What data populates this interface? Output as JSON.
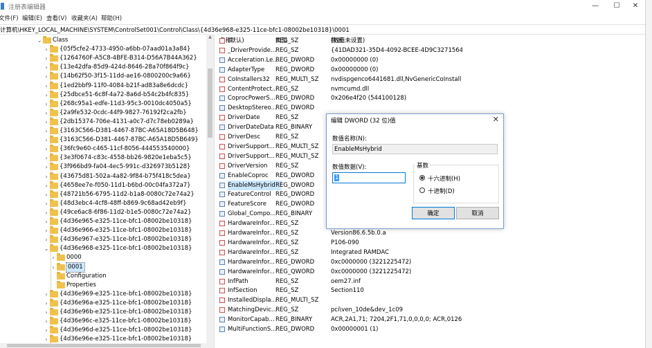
{
  "window": {
    "title": "注册表编辑器",
    "controls": {
      "minimize": "—",
      "maximize": "☐",
      "close": "✕"
    }
  },
  "menu": [
    "文件(F)",
    "编辑(E)",
    "查看(V)",
    "收藏夹(A)",
    "帮助(H)"
  ],
  "address": "计算机\\HKEY_LOCAL_MACHINE\\SYSTEM\\ControlSet001\\Control\\Class\\{4d36e968-e325-11ce-bfc1-08002be10318}\\0001",
  "tree": {
    "root": "Class",
    "items": [
      "{05f5cfe2-4733-4950-a6bb-07aad01a3a84}",
      "{1264760F-A5C8-4BFE-B314-D56A7B44A362}",
      "{13e42dfa-85d9-424d-8646-28a70f864f9c}",
      "{14b62f50-3f15-11dd-ae16-0800200c9a66}",
      "{1ed2bbf9-11f0-4084-b21f-ad83a8e6dcdc}",
      "{25dbce51-6c8f-4a72-8a6d-b54c2b4fc835}",
      "{268c95a1-edfe-11d3-95c3-0010dc4050a5}",
      "{2a9fe532-0cdc-44f9-9827-76192f2ca2fb}",
      "{2db15374-706e-4131-a0c7-d7c78eb0289a}",
      "{3163C566-D381-4467-87BC-A65A18D5B648}",
      "{3163C566-D381-4467-87BC-A65A18D5B649}",
      "{36fc9e60-c465-11cf-8056-444553540000}",
      "{3e3f0674-c83c-4558-bb26-9820e1eba5c5}",
      "{3f966bd9-fa04-4ec5-991c-d326973b5128}",
      "{43675d81-502a-4a82-9f84-b75f418c5dea}",
      "{4658ee7e-f050-11d1-b6bd-00c04fa372a7}",
      "{48721b56-6795-11d2-b1a8-0080c72e74a2}",
      "{48d3ebc4-4cf8-48ff-b869-9c68ad42eb9f}",
      "{49ce6ac8-6f86-11d2-b1e5-0080c72e74a2}",
      "{4d36e965-e325-11ce-bfc1-08002be10318}",
      "{4d36e966-e325-11ce-bfc1-08002be10318}",
      "{4d36e967-e325-11ce-bfc1-08002be10318}",
      "{4d36e968-e325-11ce-bfc1-08002be10318}"
    ],
    "children": [
      "0000",
      "0001",
      "Configuration",
      "Properties"
    ],
    "after": [
      "{4d36e969-e325-11ce-bfc1-08002be10318}",
      "{4d36e96a-e325-11ce-bfc1-08002be10318}",
      "{4d36e96b-e325-11ce-bfc1-08002be10318}",
      "{4d36e96c-e325-11ce-bfc1-08002be10318}",
      "{4d36e96d-e325-11ce-bfc1-08002be10318}",
      "{4d36e96e-e325-11ce-bfc1-08002be10318}"
    ]
  },
  "values": {
    "headers": {
      "name": "名称",
      "type": "类型",
      "data": "数据"
    },
    "rows": [
      {
        "name": "(默认)",
        "type": "REG_SZ",
        "data": "(数值未设置)",
        "icon": "ab"
      },
      {
        "name": "_DriverProvide...",
        "type": "REG_SZ",
        "data": "{41DAD321-35D4-4092-BCEE-4D9C32715647}",
        "icon": "ab"
      },
      {
        "name": "Acceleration.Le...",
        "type": "REG_DWORD",
        "data": "0x00000000 (0)",
        "icon": "bin"
      },
      {
        "name": "AdapterType",
        "type": "REG_DWORD",
        "data": "0x00000000 (0)",
        "icon": "bin"
      },
      {
        "name": "CoInstallers32",
        "type": "REG_MULTI_SZ",
        "data": "nvdispgenco6441681.dll,NvGenericCoInstall n...",
        "icon": "ab"
      },
      {
        "name": "ContentProtect...",
        "type": "REG_SZ",
        "data": "nvmcumd.dll",
        "icon": "ab"
      },
      {
        "name": "CoprocPowerS...",
        "type": "REG_DWORD",
        "data": "0x206e4f20 (544100128)",
        "icon": "bin"
      },
      {
        "name": "DesktopStereo...",
        "type": "REG_DWORD",
        "data": "",
        "icon": "bin"
      },
      {
        "name": "DriverDate",
        "type": "REG_SZ",
        "data": "",
        "icon": "ab"
      },
      {
        "name": "DriverDateData",
        "type": "REG_BINARY",
        "data": "",
        "icon": "bin"
      },
      {
        "name": "DriverDesc",
        "type": "REG_SZ",
        "data": "",
        "icon": "ab"
      },
      {
        "name": "DriverSupport...",
        "type": "REG_MULTI_SZ",
        "data": "",
        "icon": "ab"
      },
      {
        "name": "DriverSupport...",
        "type": "REG_MULTI_SZ",
        "data": "",
        "icon": "ab"
      },
      {
        "name": "DriverVersion",
        "type": "REG_SZ",
        "data": "",
        "icon": "ab"
      },
      {
        "name": "EnableCoproc",
        "type": "REG_DWORD",
        "data": "",
        "icon": "bin"
      },
      {
        "name": "EnableMsHybrid",
        "type": "REG_DWORD",
        "data": "",
        "icon": "bin",
        "selected": true
      },
      {
        "name": "FeatureControl",
        "type": "REG_DWORD",
        "data": "",
        "icon": "bin"
      },
      {
        "name": "FeatureScore",
        "type": "REG_DWORD",
        "data": "",
        "icon": "bin"
      },
      {
        "name": "Global_Compo...",
        "type": "REG_BINARY",
        "data": "",
        "icon": "bin"
      },
      {
        "name": "HardwareInfor...",
        "type": "REG_SZ",
        "data": "P106-090",
        "icon": "ab"
      },
      {
        "name": "HardwareInfor...",
        "type": "REG_SZ",
        "data": "Version86.6.5b.0.a",
        "icon": "ab"
      },
      {
        "name": "HardwareInfor...",
        "type": "REG_SZ",
        "data": "P106-090",
        "icon": "ab"
      },
      {
        "name": "HardwareInfor...",
        "type": "REG_SZ",
        "data": "Integrated RAMDAC",
        "icon": "ab"
      },
      {
        "name": "HardwareInfor...",
        "type": "REG_DWORD",
        "data": "0xc0000000 (3221225472)",
        "icon": "bin"
      },
      {
        "name": "HardwareInfor...",
        "type": "REG_QWORD",
        "data": "0xc0000000 (3221225472)",
        "icon": "bin"
      },
      {
        "name": "InfPath",
        "type": "REG_SZ",
        "data": "oem27.inf",
        "icon": "ab"
      },
      {
        "name": "InfSection",
        "type": "REG_SZ",
        "data": "Section110",
        "icon": "ab"
      },
      {
        "name": "InstalledDispla...",
        "type": "REG_MULTI_SZ",
        "data": "",
        "icon": "ab"
      },
      {
        "name": "MatchingDevic...",
        "type": "REG_SZ",
        "data": "pci\\ven_10de&dev_1c09",
        "icon": "ab"
      },
      {
        "name": "MonitorCapab...",
        "type": "REG_BINARY",
        "data": "ACR,2A1,71; 7204,2F1,71,0,0,0,0; ACR,0126,70;",
        "icon": "bin"
      },
      {
        "name": "MultiFunctionS...",
        "type": "REG_DWORD",
        "data": "0x00000001 (1)",
        "icon": "bin"
      }
    ]
  },
  "dialog": {
    "title": "编辑 DWORD (32 位)值",
    "close": "✕",
    "name_label": "数值名称(N):",
    "name_value": "EnableMsHybrid",
    "data_label": "数值数据(V):",
    "data_value": "1",
    "base_label": "基数",
    "hex_label": "十六进制(H)",
    "dec_label": "十进制(D)",
    "base_selected": "hex",
    "ok": "确定",
    "cancel": "取消"
  }
}
